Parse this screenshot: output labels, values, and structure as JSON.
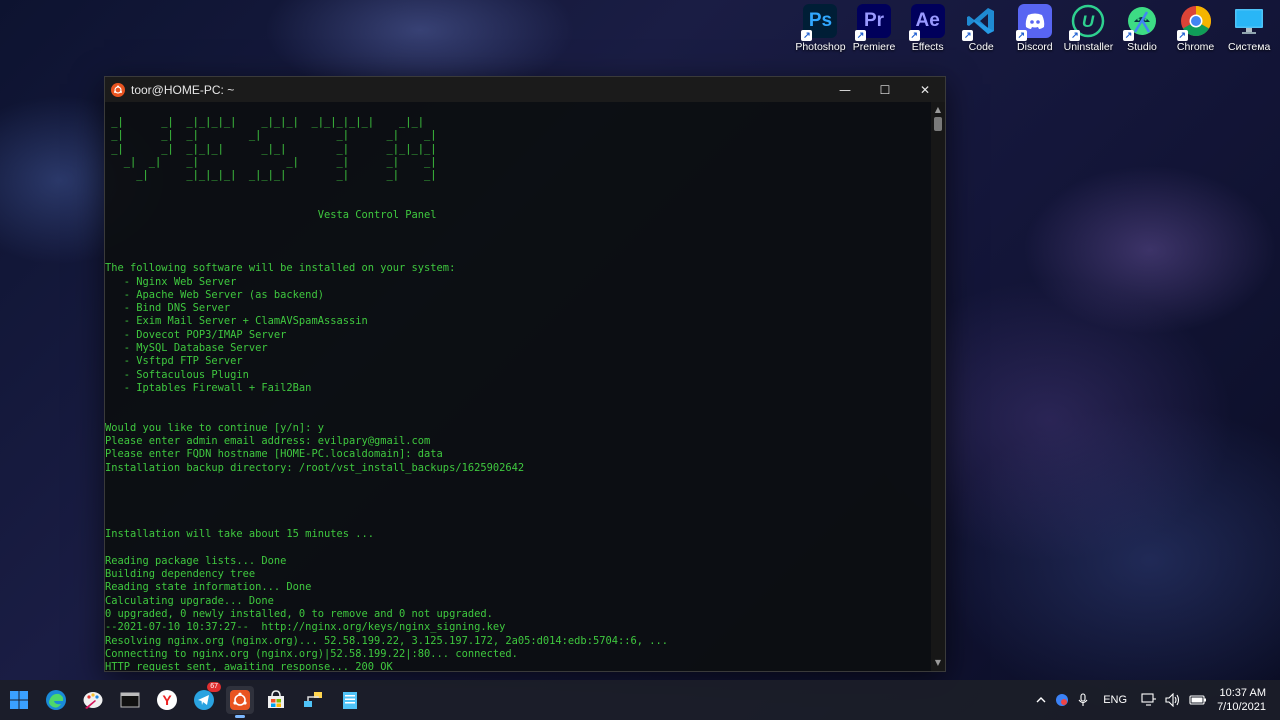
{
  "desktop": {
    "icons": [
      {
        "label": "Photoshop",
        "glyph": "Ps"
      },
      {
        "label": "Premiere",
        "glyph": "Pr"
      },
      {
        "label": "Effects",
        "glyph": "Ae"
      },
      {
        "label": "Code",
        "glyph": ""
      },
      {
        "label": "Discord",
        "glyph": ""
      },
      {
        "label": "Uninstaller",
        "glyph": "U"
      },
      {
        "label": "Studio",
        "glyph": ""
      },
      {
        "label": "Chrome",
        "glyph": ""
      },
      {
        "label": "Система",
        "glyph": ""
      }
    ]
  },
  "window": {
    "title": "toor@HOME-PC: ~",
    "controls": {
      "minimize": "—",
      "maximize": "☐",
      "close": "✕"
    },
    "terminal_lines": [
      " _|      _|  _|_|_|_|    _|_|_|  _|_|_|_|_|    _|_|",
      " _|      _|  _|        _|            _|      _|    _|",
      " _|      _|  _|_|_|      _|_|        _|      _|_|_|_|",
      "   _|  _|    _|              _|      _|      _|    _|",
      "     _|      _|_|_|_|  _|_|_|        _|      _|    _|",
      "",
      "",
      "                                  Vesta Control Panel",
      "",
      "",
      "",
      "The following software will be installed on your system:",
      "   - Nginx Web Server",
      "   - Apache Web Server (as backend)",
      "   - Bind DNS Server",
      "   - Exim Mail Server + ClamAVSpamAssassin",
      "   - Dovecot POP3/IMAP Server",
      "   - MySQL Database Server",
      "   - Vsftpd FTP Server",
      "   - Softaculous Plugin",
      "   - Iptables Firewall + Fail2Ban",
      "",
      "",
      "Would you like to continue [y/n]: y",
      "Please enter admin email address: evilpary@gmail.com",
      "Please enter FQDN hostname [HOME-PC.localdomain]: data",
      "Installation backup directory: /root/vst_install_backups/1625902642",
      "",
      "",
      "",
      "",
      "Installation will take about 15 minutes ...",
      "",
      "Reading package lists... Done",
      "Building dependency tree",
      "Reading state information... Done",
      "Calculating upgrade... Done",
      "0 upgraded, 0 newly installed, 0 to remove and 0 not upgraded.",
      "--2021-07-10 10:37:27--  http://nginx.org/keys/nginx_signing.key",
      "Resolving nginx.org (nginx.org)... 52.58.199.22, 3.125.197.172, 2a05:d014:edb:5704::6, ...",
      "Connecting to nginx.org (nginx.org)|52.58.199.22|:80... connected.",
      "HTTP request sent, awaiting response... 200 OK"
    ]
  },
  "taskbar": {
    "telegram_badge": "67",
    "tray": {
      "language": "ENG",
      "time": "10:37 AM",
      "date": "7/10/2021"
    }
  },
  "colors": {
    "terminal_text": "#3fc83f",
    "terminal_bg": "#0c0e10",
    "taskbar_bg": "#1c1e28",
    "ubuntu_orange": "#e95420"
  }
}
